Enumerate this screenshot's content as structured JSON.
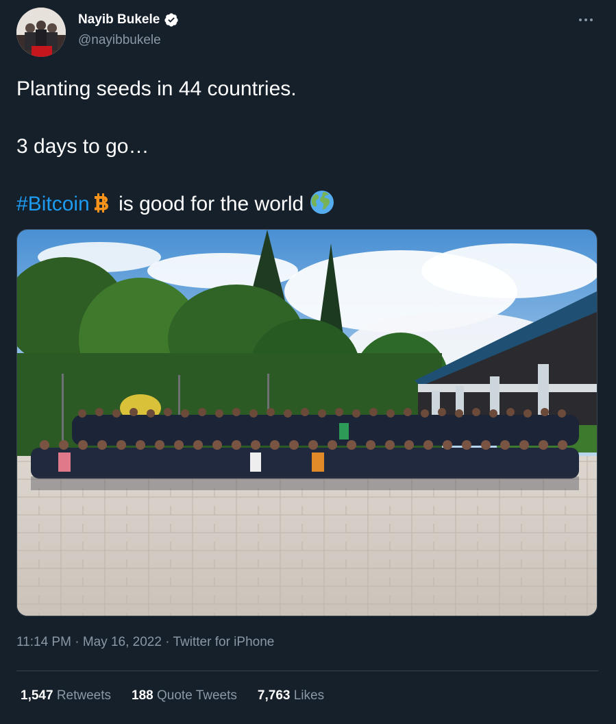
{
  "author": {
    "display_name": "Nayib Bukele",
    "handle": "@nayibbukele",
    "verified": true
  },
  "tweet": {
    "line1": "Planting seeds in 44 countries.",
    "line2": "3 days to go…",
    "hashtag": "#Bitcoin",
    "line3_rest": " is good for the world",
    "emojis": [
      "bitcoin-logo-icon",
      "globe-earth-icon"
    ]
  },
  "media": {
    "kind": "photo",
    "subject": "group-photo-outdoors"
  },
  "meta": {
    "time": "11:14 PM",
    "separator": "·",
    "date": "May 16, 2022",
    "source": "Twitter for iPhone"
  },
  "stats": {
    "retweets_count": "1,547",
    "retweets_label": "Retweets",
    "quotes_count": "188",
    "quotes_label": "Quote Tweets",
    "likes_count": "7,763",
    "likes_label": "Likes"
  },
  "colors": {
    "background": "#15202b",
    "text_primary": "#ffffff",
    "text_secondary": "#8b98a5",
    "link": "#1d9bf0",
    "divider": "#38444d",
    "bitcoin_orange": "#f7931a"
  }
}
